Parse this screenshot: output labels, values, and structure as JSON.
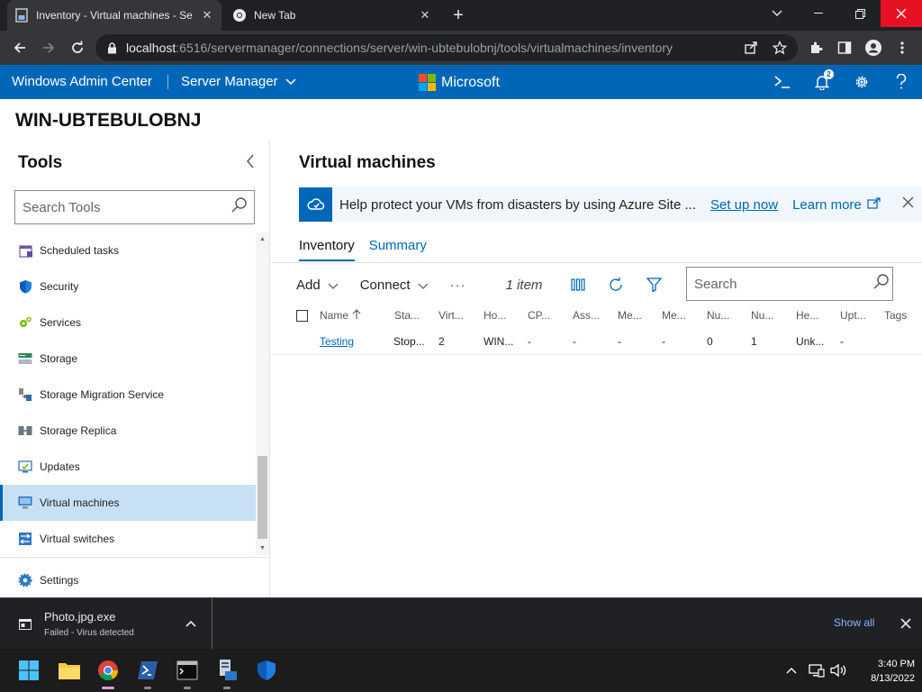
{
  "browser": {
    "tabs": [
      {
        "title": "Inventory - Virtual machines - Se",
        "active": true
      },
      {
        "title": "New Tab",
        "active": false
      }
    ],
    "url_host": "localhost",
    "url_rest": ":6516/servermanager/connections/server/win-ubtebulobnj/tools/virtualmachines/inventory"
  },
  "header": {
    "brand": "Windows Admin Center",
    "context": "Server Manager",
    "company": "Microsoft",
    "notification_count": "2",
    "colors": {
      "bar": "#0067b8"
    }
  },
  "server": {
    "name": "WIN-UBTEBULOBNJ"
  },
  "tools": {
    "title": "Tools",
    "search_placeholder": "Search Tools",
    "items": [
      {
        "label": "Scheduled tasks",
        "icon": "calendar-icon",
        "selected": false
      },
      {
        "label": "Security",
        "icon": "shield-icon",
        "selected": false
      },
      {
        "label": "Services",
        "icon": "gears-icon",
        "selected": false
      },
      {
        "label": "Storage",
        "icon": "storage-icon",
        "selected": false
      },
      {
        "label": "Storage Migration Service",
        "icon": "migration-icon",
        "selected": false
      },
      {
        "label": "Storage Replica",
        "icon": "replica-icon",
        "selected": false
      },
      {
        "label": "Updates",
        "icon": "updates-icon",
        "selected": false
      },
      {
        "label": "Virtual machines",
        "icon": "vm-icon",
        "selected": true
      },
      {
        "label": "Virtual switches",
        "icon": "switch-icon",
        "selected": false
      }
    ],
    "settings_label": "Settings"
  },
  "main": {
    "title": "Virtual machines",
    "banner": {
      "text": "Help protect your VMs from disasters by using Azure Site ...",
      "setup_link": "Set up now",
      "learn_link": "Learn more"
    },
    "tabs": [
      "Inventory",
      "Summary"
    ],
    "active_tab": "Inventory",
    "commands": {
      "add": "Add",
      "connect": "Connect",
      "more": "···",
      "item_count": "1 item"
    },
    "search_placeholder": "Search",
    "columns": [
      "Name",
      "Sta...",
      "Virt...",
      "Ho...",
      "CP...",
      "Ass...",
      "Me...",
      "Me...",
      "Nu...",
      "Nu...",
      "He...",
      "Upt...",
      "Tags"
    ],
    "rows": [
      [
        "Testing",
        "Stop...",
        "2",
        "WIN...",
        "-",
        "-",
        "-",
        "-",
        "0",
        "1",
        "Unk...",
        "-",
        ""
      ]
    ]
  },
  "download": {
    "filename": "Photo.jpg.exe",
    "status": "Failed - Virus detected",
    "show_all": "Show all"
  },
  "taskbar": {
    "time": "3:40 PM",
    "date": "8/13/2022"
  }
}
